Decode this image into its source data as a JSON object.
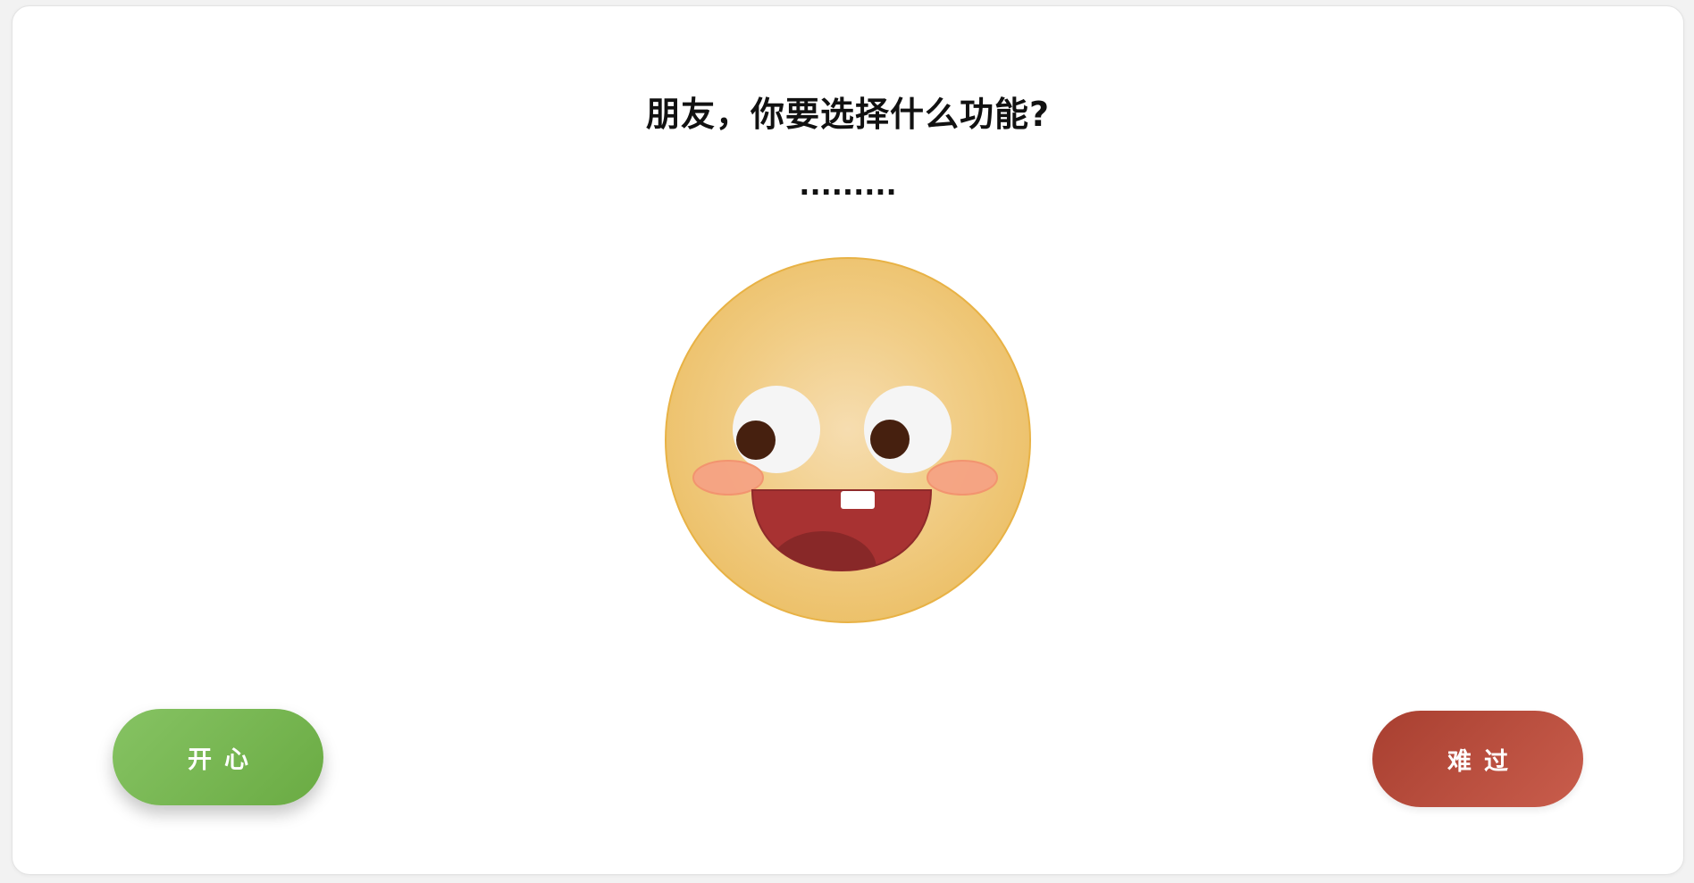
{
  "question": "朋友，你要选择什么功能?",
  "status_text": ".........",
  "buttons": {
    "happy_label": "开心",
    "sad_label": "难过"
  },
  "face": {
    "expression": "happy",
    "icon": "smiley-face-icon"
  },
  "colors": {
    "happy_button": "#77b854",
    "sad_button": "#b84a3b",
    "face_skin": "#f0c674",
    "mouth": "#a83232",
    "cheek": "#f6a384"
  }
}
